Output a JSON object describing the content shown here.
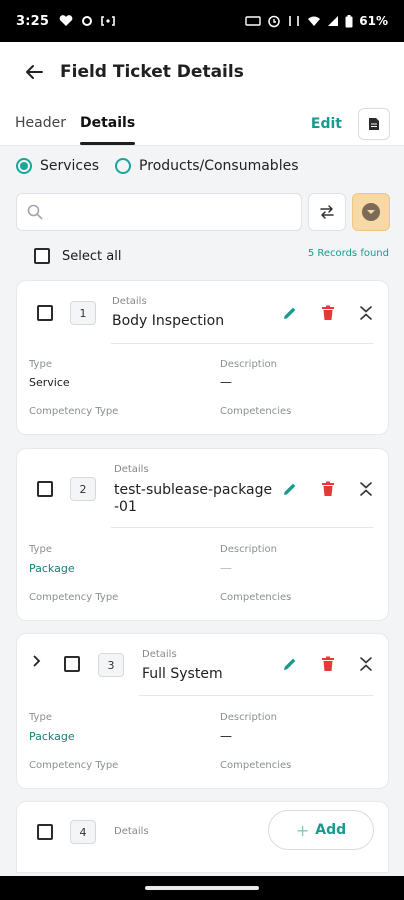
{
  "status_bar": {
    "time": "3:25",
    "battery": "61%"
  },
  "header": {
    "title": "Field Ticket Details"
  },
  "tabs": {
    "header": "Header",
    "details": "Details",
    "edit": "Edit"
  },
  "radio": {
    "services": "Services",
    "products": "Products/Consumables",
    "selected": "Services"
  },
  "search": {
    "value": "",
    "placeholder": ""
  },
  "select_all": {
    "label": "Select all",
    "records": "5 Records found"
  },
  "card_labels": {
    "details": "Details",
    "type": "Type",
    "description": "Description",
    "competency_type": "Competency Type",
    "competencies": "Competencies"
  },
  "items": [
    {
      "number": "1",
      "name": "Body Inspection",
      "type": "Service",
      "description": "—"
    },
    {
      "number": "2",
      "name_line1": "test-sublease-package",
      "name_line2": "-01",
      "type": "Package",
      "description": "—"
    },
    {
      "number": "3",
      "name": "Full System",
      "type": "Package",
      "description": "—"
    },
    {
      "number": "4"
    }
  ],
  "add_button": {
    "label": "Add"
  },
  "colors": {
    "accent": "#1a9a8f",
    "delete": "#e53935",
    "filter_bg": "#f7d9a6"
  },
  "icons": [
    "back-arrow-icon",
    "document-icon",
    "search-icon",
    "swap-icon",
    "filter-icon",
    "edit-pencil-icon",
    "trash-icon",
    "collapse-icon",
    "chevron-right-icon",
    "plus-icon"
  ]
}
